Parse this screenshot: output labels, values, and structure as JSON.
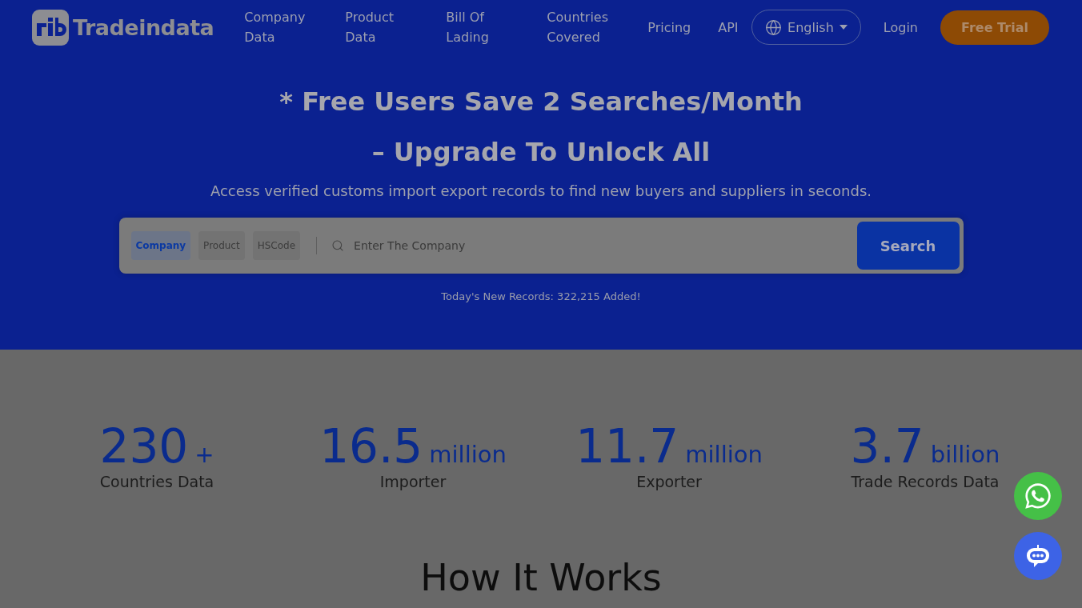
{
  "header": {
    "logo": "Tradeindata",
    "nav": [
      {
        "label": "Company Data"
      },
      {
        "label": "Product Data"
      },
      {
        "label": "Bill Of Lading"
      },
      {
        "label": "Countries Covered"
      },
      {
        "label": "Pricing"
      },
      {
        "label": "API"
      }
    ],
    "language": {
      "label": "English"
    },
    "login": "Login",
    "cta": "Free Trial"
  },
  "hero": {
    "title_lines": [
      "* Free Users Save 2 Searches/Month",
      "– Upgrade To Unlock All"
    ],
    "subtitle": "Access verified customs import export records to find new buyers and suppliers in seconds.",
    "search": {
      "tabs": [
        {
          "label": "Company",
          "selected": true
        },
        {
          "label": "Product",
          "selected": false
        },
        {
          "label": "HSCode",
          "selected": false
        }
      ],
      "placeholder": "Enter The Company",
      "button": "Search"
    },
    "records_note": "Today's New Records: 322,215 Added!"
  },
  "stats": [
    {
      "value": "230",
      "unit": "+",
      "label": "Countries Data"
    },
    {
      "value": "16.5",
      "unit": "million",
      "label": "Importer"
    },
    {
      "value": "11.7",
      "unit": "million",
      "label": "Exporter"
    },
    {
      "value": "3.7",
      "unit": "billion",
      "label": "Trade Records Data"
    }
  ],
  "section": {
    "heading": "How It Works"
  }
}
